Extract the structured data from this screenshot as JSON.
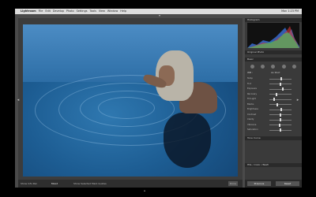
{
  "menubar": {
    "apple_glyph": "",
    "items": [
      "Lightroom",
      "File",
      "Edit",
      "Develop",
      "Photo",
      "Settings",
      "Tools",
      "View",
      "Window",
      "Help"
    ],
    "clock": "Mon 1:23 PM"
  },
  "panel": {
    "histogram_label": "Histogram",
    "section_label": "Original Photo",
    "basic_label": "Basic",
    "wb_label": "WB :",
    "wb_value": "As Shot",
    "sliders": [
      {
        "label": "Temp",
        "value": 0.55
      },
      {
        "label": "Tint",
        "value": 0.5
      },
      {
        "label": "Exposure",
        "value": 0.6
      },
      {
        "label": "Recovery",
        "value": 0.3
      },
      {
        "label": "Fill Light",
        "value": 0.2
      },
      {
        "label": "Blacks",
        "value": 0.35
      },
      {
        "label": "Brightness",
        "value": 0.55
      },
      {
        "label": "Contrast",
        "value": 0.5
      },
      {
        "label": "Clarity",
        "value": 0.5
      },
      {
        "label": "Vibrance",
        "value": 0.45
      },
      {
        "label": "Saturation",
        "value": 0.5
      }
    ],
    "tone_curve_label": "Tone Curve",
    "hsl_label": "HSL / Color / B&W",
    "buttons": {
      "previous": "Previous",
      "reset": "Reset"
    }
  },
  "bottom": {
    "left_label": "Show Info Pan",
    "mode": "Mood",
    "flag_text": "Show Selected Mark Guides",
    "done": "Done"
  },
  "colors": {
    "accent": "#2f78b0",
    "panel_bg": "#3a3a3a"
  }
}
